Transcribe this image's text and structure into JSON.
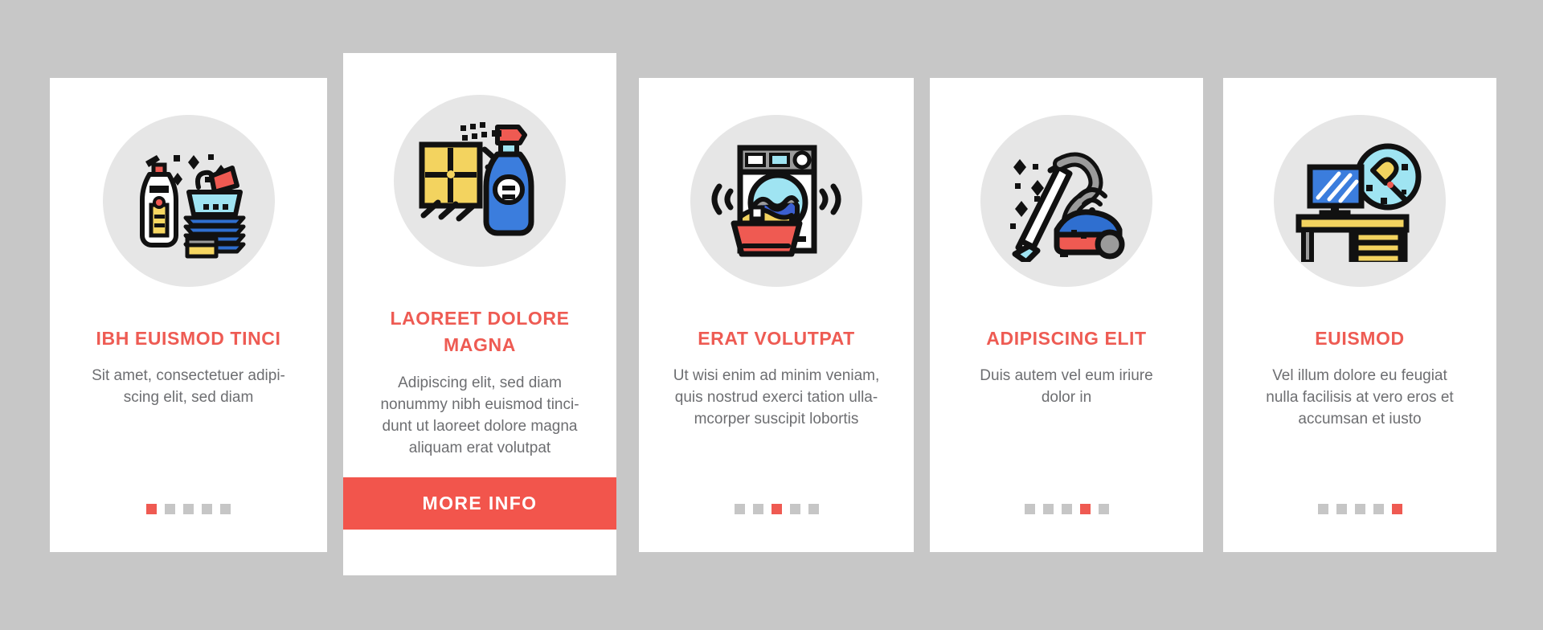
{
  "page": {
    "background_color": "#c7c7c7",
    "card_background": "#ffffff",
    "accent_color": "#ee5b53",
    "button_color": "#f2554c",
    "body_text_color": "#6d6e71",
    "icon_disc_color": "#e6e6e6",
    "dot_inactive_color": "#c6c6c6",
    "dot_active_color": "#ef5a52"
  },
  "cards": [
    {
      "id": "card-1",
      "icon_name": "dish-soap-and-clean-dishes-icon",
      "title": "IBH EUISMOD TINCI",
      "body": "Sit amet, consectetuer adipi-\nscing elit, sed diam",
      "dots": {
        "total": 5,
        "active_index": 0
      },
      "has_button": false
    },
    {
      "id": "card-2",
      "icon_name": "window-spray-cleaner-icon",
      "title": "LAOREET DOLORE MAGNA",
      "body": "Adipiscing elit, sed diam\nnonummy nibh euismod tinci-\ndunt ut laoreet dolore magna\naliquam erat volutpat",
      "dots": null,
      "has_button": true,
      "button_label": "MORE INFO"
    },
    {
      "id": "card-3",
      "icon_name": "washing-machine-laundry-icon",
      "title": "ERAT VOLUTPAT",
      "body": "Ut wisi enim ad minim veniam,\nquis nostrud exerci tation ulla-\nmcorper suscipit lobortis",
      "dots": {
        "total": 5,
        "active_index": 2
      },
      "has_button": false
    },
    {
      "id": "card-4",
      "icon_name": "vacuum-cleaner-icon",
      "title": "ADIPISCING ELIT",
      "body": "Duis autem vel eum iriure\ndolor in",
      "dots": {
        "total": 5,
        "active_index": 3
      },
      "has_button": false
    },
    {
      "id": "card-5",
      "icon_name": "desk-dusting-icon",
      "title": "EUISMOD",
      "body": "Vel illum dolore eu feugiat\nnulla facilisis at vero eros et\naccumsan et iusto",
      "dots": {
        "total": 5,
        "active_index": 4
      },
      "has_button": false
    }
  ]
}
